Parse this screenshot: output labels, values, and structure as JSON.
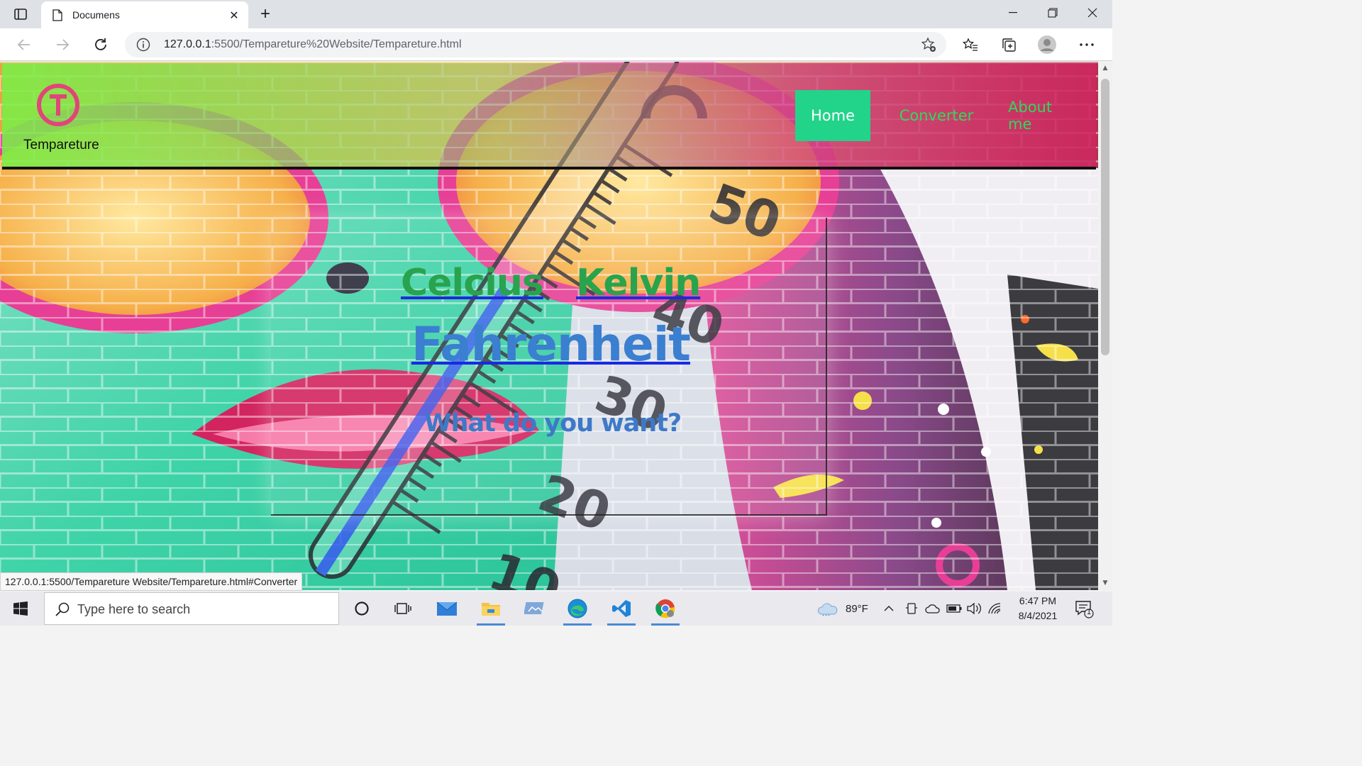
{
  "browser": {
    "tab_title": "Documens",
    "url_host": "127.0.0.1",
    "url_rest": ":5500/Tempareture%20Website/Tempareture.html",
    "status_url": "127.0.0.1:5500/Tempareture Website/Tempareture.html#Converter"
  },
  "site": {
    "brand": "Tempareture",
    "logo_letter": "T",
    "nav": [
      {
        "label": "Home"
      },
      {
        "label": "Converter"
      },
      {
        "label": "About me"
      }
    ],
    "options": {
      "celsius": "Celcius",
      "kelvin": "Kelvin",
      "fahrenheit": "Fahrenheit"
    },
    "question": "What do you want?",
    "thermometer_labels": [
      "50",
      "40",
      "30",
      "20",
      "10"
    ]
  },
  "taskbar": {
    "search_placeholder": "Type here to search",
    "weather": "89°F",
    "time": "6:47 PM",
    "date": "8/4/2021",
    "notification_count": "1"
  },
  "colors": {
    "nav_active_bg": "#22d38a",
    "nav_link": "#2bdc5a",
    "option_green": "#29a34d",
    "fahrenheit_blue": "#3b7fd0",
    "logo_pink": "#e2457a"
  }
}
